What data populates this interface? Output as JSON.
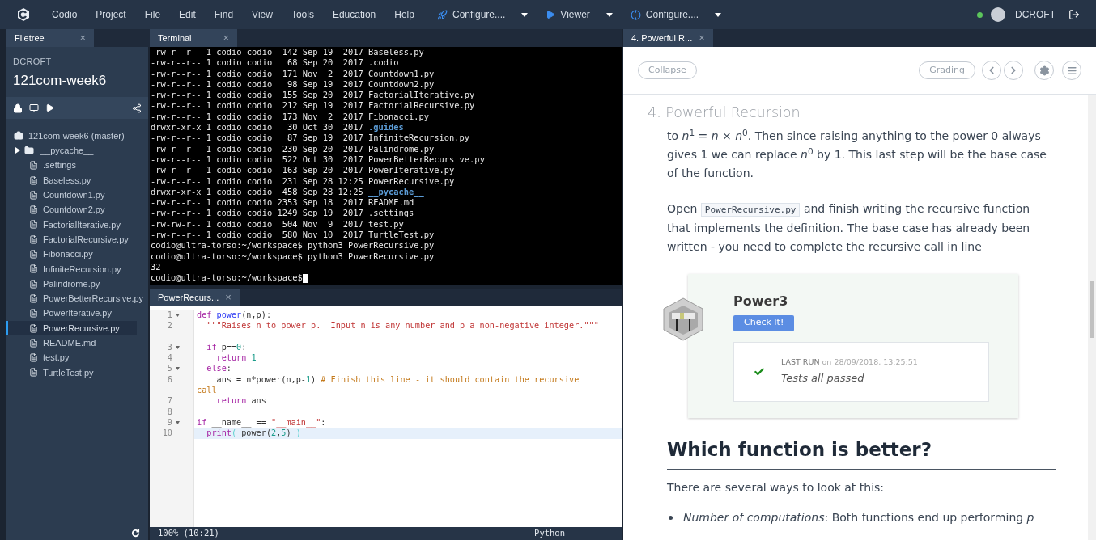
{
  "menu_bar": {
    "items": [
      "Codio",
      "Project",
      "File",
      "Edit",
      "Find",
      "View",
      "Tools",
      "Education",
      "Help"
    ],
    "tools": [
      {
        "label": "Configure....",
        "kind": "rocket"
      },
      {
        "label": "Viewer",
        "kind": "play"
      },
      {
        "label": "Configure....",
        "kind": "diamond"
      }
    ],
    "user": "DCROFT",
    "online": true
  },
  "filetree": {
    "tab": "Filetree",
    "close": "×",
    "owner": "DCROFT",
    "project": "121com-week6",
    "items": [
      {
        "label": "121com-week6 (master)",
        "kind": "repo",
        "selected": false
      },
      {
        "label": "__pycache__",
        "kind": "folder",
        "selected": false,
        "expanded": false
      },
      {
        "label": ".settings",
        "kind": "file",
        "selected": false
      },
      {
        "label": "Baseless.py",
        "kind": "file",
        "selected": false
      },
      {
        "label": "Countdown1.py",
        "kind": "file",
        "selected": false
      },
      {
        "label": "Countdown2.py",
        "kind": "file",
        "selected": false
      },
      {
        "label": "FactorialIterative.py",
        "kind": "file",
        "selected": false
      },
      {
        "label": "FactorialRecursive.py",
        "kind": "file",
        "selected": false
      },
      {
        "label": "Fibonacci.py",
        "kind": "file",
        "selected": false
      },
      {
        "label": "InfiniteRecursion.py",
        "kind": "file",
        "selected": false
      },
      {
        "label": "Palindrome.py",
        "kind": "file",
        "selected": false
      },
      {
        "label": "PowerBetterRecursive.py",
        "kind": "file",
        "selected": false
      },
      {
        "label": "PowerIterative.py",
        "kind": "file",
        "selected": false
      },
      {
        "label": "PowerRecursive.py",
        "kind": "file",
        "selected": true
      },
      {
        "label": "README.md",
        "kind": "file",
        "selected": false
      },
      {
        "label": "test.py",
        "kind": "file",
        "selected": false
      },
      {
        "label": "TurtleTest.py",
        "kind": "file",
        "selected": false
      }
    ]
  },
  "terminal": {
    "tab": "Terminal",
    "close": "×",
    "lines": [
      {
        "kind": "file",
        "meta": "-rw-r--r-- 1 codio codio  142 Sep 19  2017 ",
        "name": "Baseless.py"
      },
      {
        "kind": "file",
        "meta": "-rw-r--r-- 1 codio codio   68 Sep 20  2017 ",
        "name": ".codio"
      },
      {
        "kind": "file",
        "meta": "-rw-r--r-- 1 codio codio  171 Nov  2  2017 ",
        "name": "Countdown1.py"
      },
      {
        "kind": "file",
        "meta": "-rw-r--r-- 1 codio codio   98 Sep 19  2017 ",
        "name": "Countdown2.py"
      },
      {
        "kind": "file",
        "meta": "-rw-r--r-- 1 codio codio  155 Sep 20  2017 ",
        "name": "FactorialIterative.py"
      },
      {
        "kind": "file",
        "meta": "-rw-r--r-- 1 codio codio  212 Sep 19  2017 ",
        "name": "FactorialRecursive.py"
      },
      {
        "kind": "file",
        "meta": "-rw-r--r-- 1 codio codio  173 Nov  2  2017 ",
        "name": "Fibonacci.py"
      },
      {
        "kind": "dir",
        "meta": "drwxr-xr-x 1 codio codio   30 Oct 30  2017 ",
        "name": ".guides"
      },
      {
        "kind": "file",
        "meta": "-rw-r--r-- 1 codio codio   87 Sep 19  2017 ",
        "name": "InfiniteRecursion.py"
      },
      {
        "kind": "file",
        "meta": "-rw-r--r-- 1 codio codio  230 Sep 20  2017 ",
        "name": "Palindrome.py"
      },
      {
        "kind": "file",
        "meta": "-rw-r--r-- 1 codio codio  522 Oct 30  2017 ",
        "name": "PowerBetterRecursive.py"
      },
      {
        "kind": "file",
        "meta": "-rw-r--r-- 1 codio codio  163 Sep 20  2017 ",
        "name": "PowerIterative.py"
      },
      {
        "kind": "file",
        "meta": "-rw-r--r-- 1 codio codio  231 Sep 28 12:25 ",
        "name": "PowerRecursive.py"
      },
      {
        "kind": "dir",
        "meta": "drwxr-xr-x 1 codio codio  458 Sep 28 12:25 ",
        "name": "__pycache__"
      },
      {
        "kind": "file",
        "meta": "-rw-r--r-- 1 codio codio 2353 Sep 18  2017 ",
        "name": "README.md"
      },
      {
        "kind": "file",
        "meta": "-rw-r--r-- 1 codio codio 1249 Sep 19  2017 ",
        "name": ".settings"
      },
      {
        "kind": "file",
        "meta": "-rw-rw-r-- 1 codio codio  504 Nov  9  2017 ",
        "name": "test.py"
      },
      {
        "kind": "file",
        "meta": "-rw-r--r-- 1 codio codio  580 Nov 10  2017 ",
        "name": "TurtleTest.py"
      },
      {
        "kind": "plain",
        "meta": "codio@ultra-torso:~/workspace$ python3 PowerRecursive.py"
      },
      {
        "kind": "plain",
        "meta": "codio@ultra-torso:~/workspace$ python3 PowerRecursive.py"
      },
      {
        "kind": "plain",
        "meta": "32"
      },
      {
        "kind": "prompt",
        "meta": "codio@ultra-torso:~/workspace$"
      }
    ]
  },
  "editor": {
    "tab": "PowerRecurs...",
    "close": "×",
    "lines": [
      {
        "number": "1",
        "fold": true,
        "current": false,
        "tokens": [
          {
            "text": "def",
            "kind": "keyword"
          },
          {
            "text": " power",
            "kind": "func"
          },
          {
            "text": "(n,p):",
            "kind": "plain"
          }
        ]
      },
      {
        "number": "2",
        "fold": false,
        "current": false,
        "blank_row_after": true,
        "tokens": [
          {
            "text": "  \"\"\"Raises n to power p.  Input n is any number and p a non-negative integer.\"\"\"",
            "kind": "string"
          }
        ]
      },
      {
        "number": "3",
        "fold": true,
        "current": false,
        "tokens": [
          {
            "text": "  if",
            "kind": "keyword"
          },
          {
            "text": " p==",
            "kind": "plain"
          },
          {
            "text": "0",
            "kind": "number"
          },
          {
            "text": ":",
            "kind": "plain"
          }
        ]
      },
      {
        "number": "4",
        "fold": false,
        "current": false,
        "tokens": [
          {
            "text": "    return",
            "kind": "keyword"
          },
          {
            "text": " 1",
            "kind": "number"
          }
        ]
      },
      {
        "number": "5",
        "fold": true,
        "current": false,
        "tokens": [
          {
            "text": "  else",
            "kind": "keyword"
          },
          {
            "text": ":",
            "kind": "plain"
          }
        ]
      },
      {
        "number": "6",
        "fold": false,
        "current": false,
        "tokens": [
          {
            "text": "    ans = n*power(n,p-",
            "kind": "plain"
          },
          {
            "text": "1",
            "kind": "number"
          },
          {
            "text": ")",
            "kind": "plain"
          },
          {
            "text": " # Finish this line - it should contain the recursive",
            "kind": "comment"
          }
        ],
        "wrap_tokens": [
          {
            "text": "call",
            "kind": "comment"
          }
        ]
      },
      {
        "number": "7",
        "fold": false,
        "current": false,
        "tokens": [
          {
            "text": "    return",
            "kind": "keyword"
          },
          {
            "text": " ans",
            "kind": "plain"
          }
        ]
      },
      {
        "number": "8",
        "fold": false,
        "current": false
      },
      {
        "number": "9",
        "fold": true,
        "current": false,
        "tokens": [
          {
            "text": "if",
            "kind": "keyword"
          },
          {
            "text": " __name__ == ",
            "kind": "plain"
          },
          {
            "text": "\"__main__\"",
            "kind": "string"
          },
          {
            "text": ":",
            "kind": "plain"
          }
        ]
      },
      {
        "number": "10",
        "fold": false,
        "current": true,
        "tokens": [
          {
            "text": "  print",
            "kind": "keyword"
          },
          {
            "text": "(",
            "kind": "bracket"
          },
          {
            "text": " power(",
            "kind": "plain"
          },
          {
            "text": "2",
            "kind": "number"
          },
          {
            "text": ",",
            "kind": "plain"
          },
          {
            "text": "5",
            "kind": "number"
          },
          {
            "text": ")",
            "kind": "plain"
          },
          {
            "text": " )",
            "kind": "bracket"
          }
        ]
      }
    ],
    "status": "100%  (10:21)",
    "language": "Python"
  },
  "guide": {
    "tab": "4. Powerful R...",
    "close": "×",
    "toolbar": {
      "collapse": "Collapse",
      "grading": "Grading"
    },
    "title": "4. Powerful Recursion",
    "paragraphs": [
      "to *n*$^{1}$ = *n* × *n*$^{0}$. Then since raising anything to the power 0 always gives 1 we can replace *n*$^{0}$ by 1. This last step will be the base case of the function."
    ],
    "open_paragraph": {
      "before": "Open",
      "code": "PowerRecursive.py",
      "after": "and finish writing the recursive function that implements the definition. The base case has already been written - you need to complete the recursive call in line"
    },
    "check": {
      "title": "Power3",
      "button": "Check It!",
      "last_run": "LAST RUN",
      "date": "on 28/09/2018, 13:25:51",
      "result": "Tests all passed",
      "passed": true
    },
    "heading": "Which function is better?",
    "intro": "There are several ways to look at this:",
    "bullets": [
      "*Number of computations*: Both functions end up performing *p*"
    ]
  }
}
